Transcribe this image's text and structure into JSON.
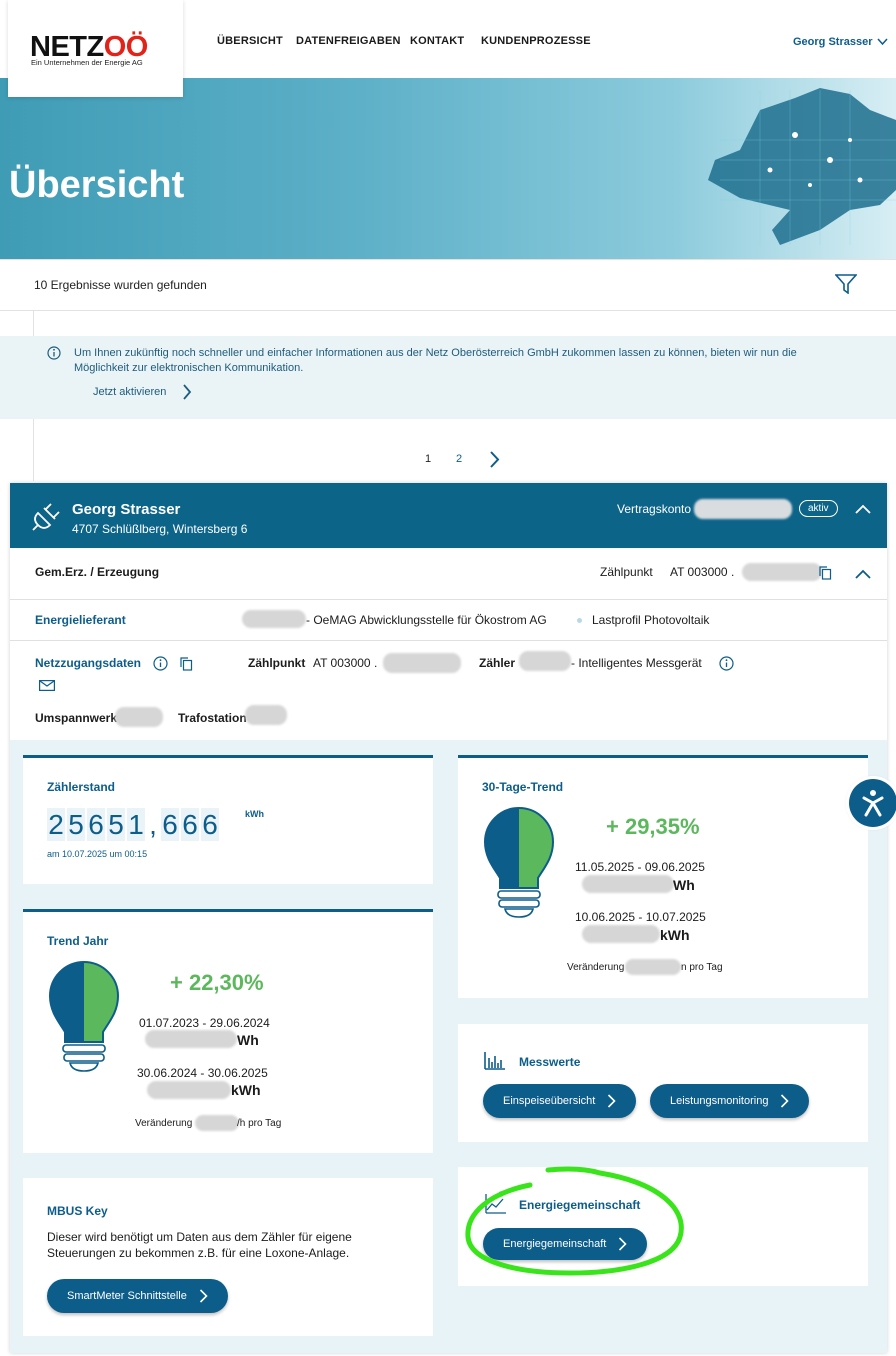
{
  "header": {
    "logo_text_a": "NETZ",
    "logo_text_b": "OÖ",
    "logo_sub": "Ein Unternehmen der Energie AG",
    "nav": [
      "ÜBERSICHT",
      "DATENFREIGABEN",
      "KONTAKT",
      "KUNDENPROZESSE"
    ],
    "user": "Georg Strasser"
  },
  "hero": {
    "title": "Übersicht"
  },
  "results": {
    "text": "10 Ergebnisse wurden gefunden"
  },
  "info": {
    "text": "Um Ihnen zukünftig noch schneller und einfacher Informationen aus der Netz Oberösterreich GmbH zukommen lassen zu können, bieten wir nun die Möglichkeit zur elektronischen Kommunikation.",
    "action": "Jetzt aktivieren"
  },
  "pagination": {
    "pages": [
      "1",
      "2"
    ]
  },
  "card": {
    "name": "Georg Strasser",
    "address": "4707 Schlüßlberg, Wintersberg 6",
    "contract_label": "Vertragskonto",
    "status": "aktiv",
    "section_title": "Gem.Erz. / Erzeugung",
    "zp_label": "Zählpunkt",
    "zp_value": "AT 003000 .",
    "supplier_label": "Energielieferant",
    "supplier_value": "- OeMAG Abwicklungsstelle für Ökostrom AG",
    "profile": "Lastprofil Photovoltaik",
    "access_label": "Netzzugangsdaten",
    "zp2_label": "Zählpunkt",
    "zp2_value": "AT 003000 .",
    "meter_label": "Zähler",
    "meter_value": "- Intelligentes Messgerät",
    "substation_label": "Umspannwerk",
    "trafo_label": "Trafostation"
  },
  "zaehlerstand": {
    "title": "Zählerstand",
    "digits": [
      "2",
      "5",
      "6",
      "5",
      "1",
      ",",
      "6",
      "6",
      "6"
    ],
    "unit": "kWh",
    "date": "am 10.07.2025 um 00:15"
  },
  "trend30": {
    "title": "30-Tage-Trend",
    "pct": "+ 29,35%",
    "range1": "11.05.2025 - 09.06.2025",
    "val1": "Wh",
    "range2": "10.06.2025 - 10.07.2025",
    "val2": "kWh",
    "change_a": "Veränderung",
    "change_b": "n pro Tag"
  },
  "trendjahr": {
    "title": "Trend Jahr",
    "pct": "+ 22,30%",
    "range1": "01.07.2023 - 29.06.2024",
    "val1": "Wh",
    "range2": "30.06.2024 - 30.06.2025",
    "val2": "kWh",
    "change_a": "Veränderung",
    "change_b": "/h pro Tag"
  },
  "messwerte": {
    "title": "Messwerte",
    "btn1": "Einspeiseübersicht",
    "btn2": "Leistungsmonitoring"
  },
  "mbus": {
    "title": "MBUS Key",
    "text": "Dieser wird benötigt um Daten aus dem Zähler für eigene Steuerungen zu bekommen z.B. für eine Loxone-Anlage.",
    "btn": "SmartMeter Schnittstelle"
  },
  "eg": {
    "title": "Energiegemeinschaft",
    "btn": "Energiegemeinschaft"
  },
  "colors": {
    "primary": "#0d5d8b",
    "green": "#5cb85c",
    "highlight": "#39e51a"
  }
}
